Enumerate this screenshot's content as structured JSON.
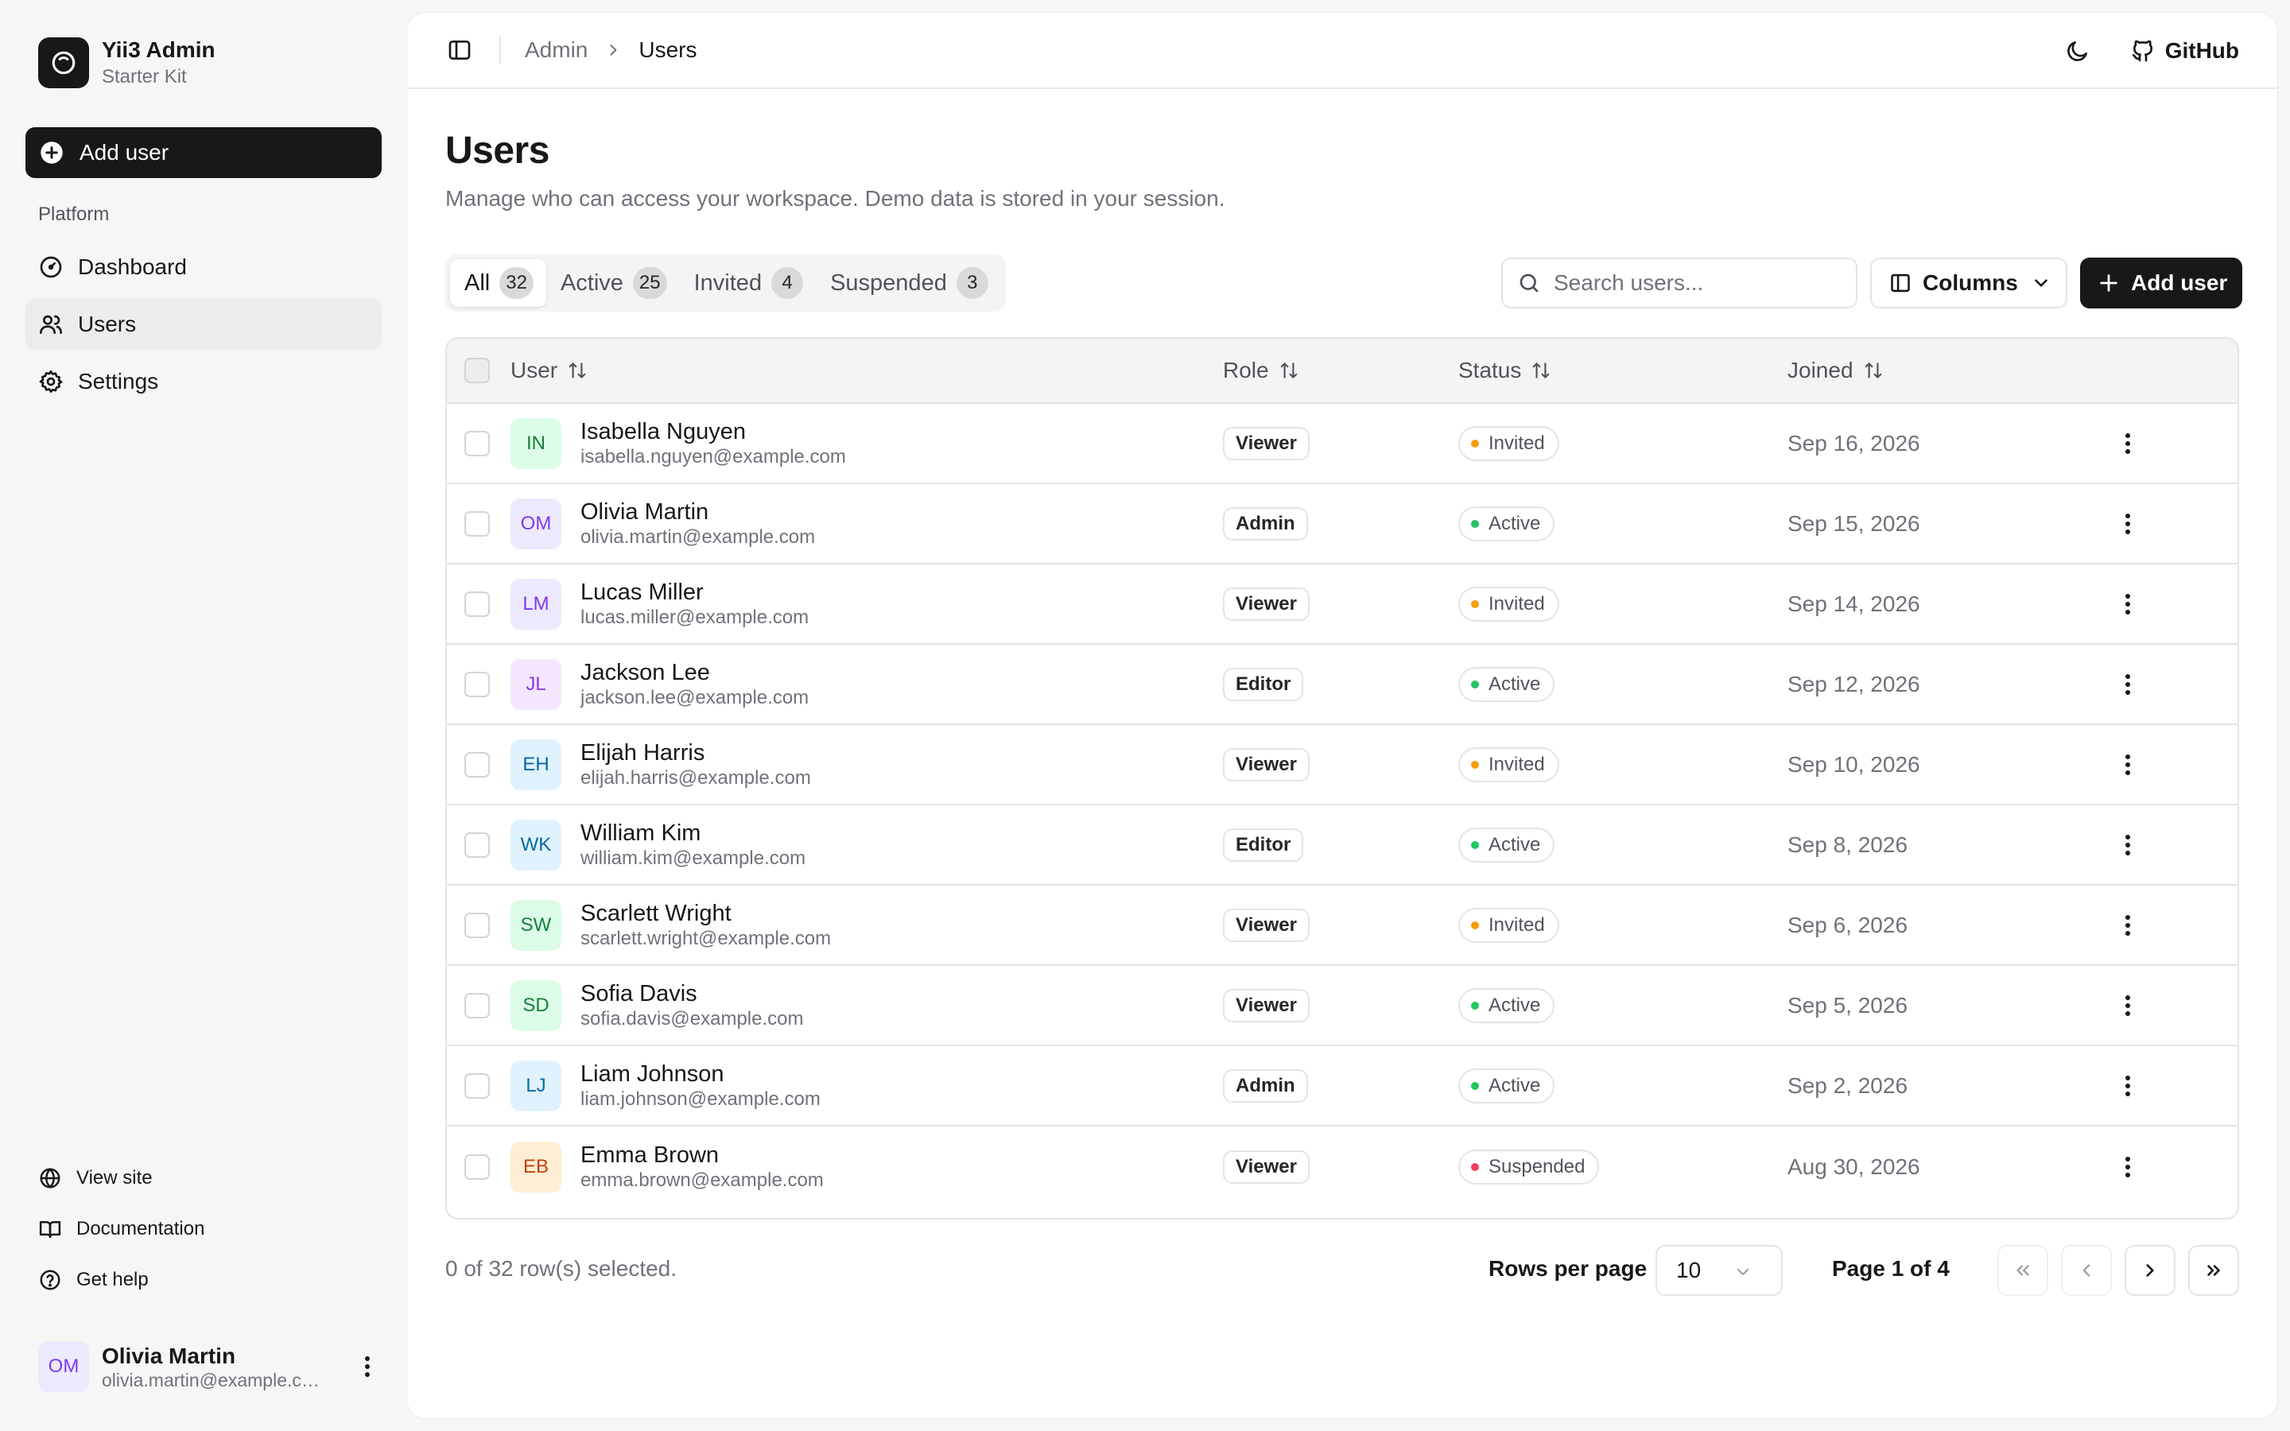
{
  "brand": {
    "title": "Yii3 Admin",
    "subtitle": "Starter Kit"
  },
  "sidebar": {
    "add_user_label": "Add user",
    "group_label": "Platform",
    "nav": [
      {
        "label": "Dashboard",
        "icon": "gauge-icon",
        "active": false
      },
      {
        "label": "Users",
        "icon": "users-icon",
        "active": true
      },
      {
        "label": "Settings",
        "icon": "gear-icon",
        "active": false
      }
    ],
    "footer_links": [
      {
        "label": "View site",
        "icon": "globe-icon"
      },
      {
        "label": "Documentation",
        "icon": "book-icon"
      },
      {
        "label": "Get help",
        "icon": "help-circle-icon"
      }
    ],
    "current_user": {
      "initials": "OM",
      "name": "Olivia Martin",
      "email": "olivia.martin@example.com"
    }
  },
  "topbar": {
    "breadcrumb": [
      "Admin",
      "Users"
    ],
    "github_label": "GitHub"
  },
  "page": {
    "title": "Users",
    "description": "Manage who can access your workspace. Demo data is stored in your session."
  },
  "tabs": [
    {
      "label": "All",
      "count": "32",
      "active": true
    },
    {
      "label": "Active",
      "count": "25",
      "active": false
    },
    {
      "label": "Invited",
      "count": "4",
      "active": false
    },
    {
      "label": "Suspended",
      "count": "3",
      "active": false
    }
  ],
  "toolbar": {
    "search_placeholder": "Search users...",
    "columns_label": "Columns",
    "add_user_label": "Add user"
  },
  "table": {
    "headers": {
      "user": "User",
      "role": "Role",
      "status": "Status",
      "joined": "Joined"
    },
    "rows": [
      {
        "initials": "IN",
        "name": "Isabella Nguyen",
        "email": "isabella.nguyen@example.com",
        "role": "Viewer",
        "status": "Invited",
        "joined": "Sep 16, 2026",
        "avatar_bg": "#dcfce7",
        "avatar_fg": "#15803d"
      },
      {
        "initials": "OM",
        "name": "Olivia Martin",
        "email": "olivia.martin@example.com",
        "role": "Admin",
        "status": "Active",
        "joined": "Sep 15, 2026",
        "avatar_bg": "#ede9fe",
        "avatar_fg": "#7c3aed"
      },
      {
        "initials": "LM",
        "name": "Lucas Miller",
        "email": "lucas.miller@example.com",
        "role": "Viewer",
        "status": "Invited",
        "joined": "Sep 14, 2026",
        "avatar_bg": "#ede9fe",
        "avatar_fg": "#7c3aed"
      },
      {
        "initials": "JL",
        "name": "Jackson Lee",
        "email": "jackson.lee@example.com",
        "role": "Editor",
        "status": "Active",
        "joined": "Sep 12, 2026",
        "avatar_bg": "#f3e8ff",
        "avatar_fg": "#9333ea"
      },
      {
        "initials": "EH",
        "name": "Elijah Harris",
        "email": "elijah.harris@example.com",
        "role": "Viewer",
        "status": "Invited",
        "joined": "Sep 10, 2026",
        "avatar_bg": "#e0f2fe",
        "avatar_fg": "#0369a1"
      },
      {
        "initials": "WK",
        "name": "William Kim",
        "email": "william.kim@example.com",
        "role": "Editor",
        "status": "Active",
        "joined": "Sep 8, 2026",
        "avatar_bg": "#e0f2fe",
        "avatar_fg": "#0369a1"
      },
      {
        "initials": "SW",
        "name": "Scarlett Wright",
        "email": "scarlett.wright@example.com",
        "role": "Viewer",
        "status": "Invited",
        "joined": "Sep 6, 2026",
        "avatar_bg": "#dcfce7",
        "avatar_fg": "#15803d"
      },
      {
        "initials": "SD",
        "name": "Sofia Davis",
        "email": "sofia.davis@example.com",
        "role": "Viewer",
        "status": "Active",
        "joined": "Sep 5, 2026",
        "avatar_bg": "#dcfce7",
        "avatar_fg": "#15803d"
      },
      {
        "initials": "LJ",
        "name": "Liam Johnson",
        "email": "liam.johnson@example.com",
        "role": "Admin",
        "status": "Active",
        "joined": "Sep 2, 2026",
        "avatar_bg": "#e0f2fe",
        "avatar_fg": "#0369a1"
      },
      {
        "initials": "EB",
        "name": "Emma Brown",
        "email": "emma.brown@example.com",
        "role": "Viewer",
        "status": "Suspended",
        "joined": "Aug 30, 2026",
        "avatar_bg": "#ffedd5",
        "avatar_fg": "#c2410c"
      }
    ]
  },
  "status_colors": {
    "Active": "#22c55e",
    "Invited": "#f59e0b",
    "Suspended": "#f43f5e"
  },
  "footer": {
    "selection_text": "0 of 32 row(s) selected.",
    "rows_per_page_label": "Rows per page",
    "rows_per_page_value": "10",
    "page_info": "Page 1 of 4"
  }
}
